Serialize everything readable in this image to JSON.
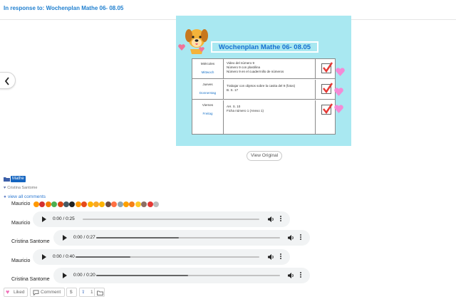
{
  "header": {
    "title": "In response to: Wochenplan Mathe 06- 08.05"
  },
  "post_image": {
    "title": "Wochenplan Mathe 06- 08.05",
    "rows": [
      {
        "day_es": "Miércoles",
        "day_de": "Mittwoch",
        "tasks": [
          "Video del número 9",
          "Número 9 con plastilina",
          "Número 9 en el cuaderrnillo de números"
        ]
      },
      {
        "day_es": "Jueves",
        "day_de": "Donnerstag",
        "tasks": [
          "Trabajar con objetos sobre la casita del 9 (fotos)",
          "B. S. 17"
        ]
      },
      {
        "day_es": "Viernes",
        "day_de": "Freitag",
        "tasks": [
          "AH. S. 10",
          "Ficha número 1 (Anexo 1)"
        ]
      }
    ],
    "colors": {
      "background": "#a9e8f1",
      "title": "#156fd0",
      "check": "#e53935",
      "heart": "#f38bd6"
    }
  },
  "view_original_label": "View Original",
  "tag": {
    "label": "Mathe",
    "icon": "folder-icon"
  },
  "author": {
    "name": "Cristina Santome",
    "icon": "heart-icon"
  },
  "view_all_comments": "view all comments",
  "emoji_comment": {
    "name": "Mauricio",
    "emoji_colors": [
      "#ff9800",
      "#d32f2f",
      "#f57c00",
      "#4caf50",
      "#d84315",
      "#455a64",
      "#212121",
      "#ff9800",
      "#e64a19",
      "#ffb300",
      "#f9a825",
      "#ffb300",
      "#6d4c41",
      "#ff7043",
      "#90a4ae",
      "#ffa000",
      "#f57f17",
      "#ffca28",
      "#8d6e63",
      "#e53935",
      "#bdbdbd"
    ]
  },
  "comments": [
    {
      "name": "Mauricio",
      "time": "0:00 / 0:25",
      "progress": 0.0
    },
    {
      "name": "Cristina Santome",
      "time": "0:00 / 0:27",
      "progress": 0.45
    },
    {
      "name": "Mauricio",
      "time": "0:00 / 0:40",
      "progress": 0.3
    },
    {
      "name": "Cristina Santome",
      "time": "0:00 / 0:20",
      "progress": 0.5
    }
  ],
  "actions": {
    "liked": "Liked",
    "comment": "Comment",
    "dollar": "$",
    "share_count": "1"
  }
}
